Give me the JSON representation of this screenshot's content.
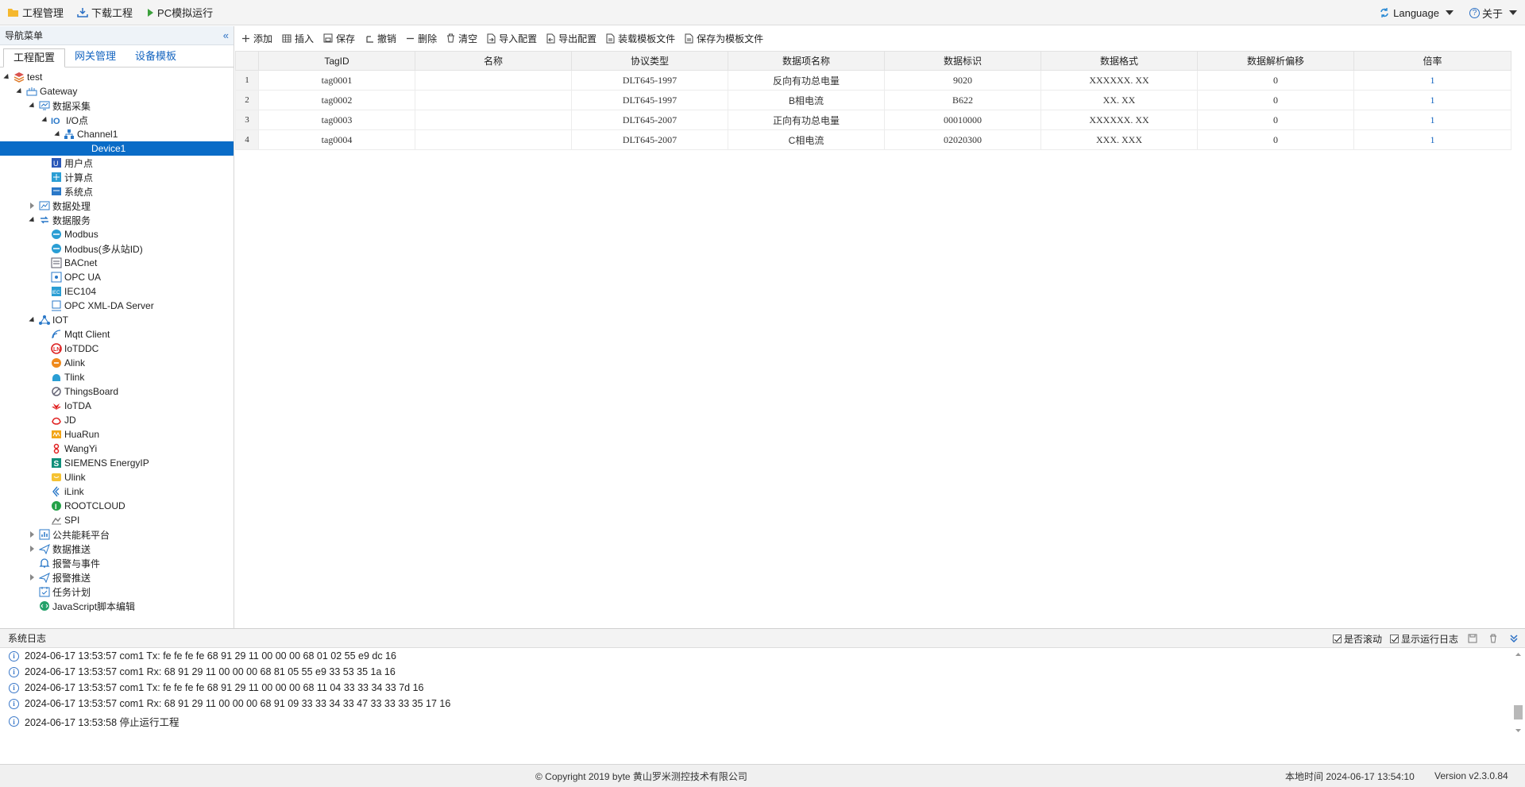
{
  "topbar": {
    "items": [
      {
        "label": "工程管理",
        "icon": "folder-icon"
      },
      {
        "label": "下载工程",
        "icon": "download-icon"
      },
      {
        "label": "PC模拟运行",
        "icon": "play-icon"
      }
    ],
    "language": "Language",
    "about": "关于"
  },
  "nav": {
    "title": "导航菜单",
    "tabs": [
      "工程配置",
      "网关管理",
      "设备模板"
    ],
    "tree": [
      {
        "label": "test",
        "level": 0,
        "toggle": "open",
        "icon": "layers-icon"
      },
      {
        "label": "Gateway",
        "level": 1,
        "toggle": "open",
        "icon": "gateway-icon"
      },
      {
        "label": "数据采集",
        "level": 2,
        "toggle": "open",
        "icon": "monitor-icon"
      },
      {
        "label": "I/O点",
        "level": 3,
        "toggle": "open",
        "icon": "io-icon"
      },
      {
        "label": "Channel1",
        "level": 4,
        "toggle": "open",
        "icon": "channel-icon"
      },
      {
        "label": "Device1",
        "level": 5,
        "toggle": "",
        "icon": "",
        "selected": true
      },
      {
        "label": "用户点",
        "level": 3,
        "toggle": "",
        "icon": "user-point-icon"
      },
      {
        "label": "计算点",
        "level": 3,
        "toggle": "",
        "icon": "calc-point-icon"
      },
      {
        "label": "系统点",
        "level": 3,
        "toggle": "",
        "icon": "system-point-icon"
      },
      {
        "label": "数据处理",
        "level": 2,
        "toggle": "closed",
        "icon": "chart-icon"
      },
      {
        "label": "数据服务",
        "level": 2,
        "toggle": "open",
        "icon": "service-icon"
      },
      {
        "label": "Modbus",
        "level": 3,
        "toggle": "",
        "icon": "modbus-icon"
      },
      {
        "label": "Modbus(多从站ID)",
        "level": 3,
        "toggle": "",
        "icon": "modbus-icon"
      },
      {
        "label": "BACnet",
        "level": 3,
        "toggle": "",
        "icon": "bacnet-icon"
      },
      {
        "label": "OPC UA",
        "level": 3,
        "toggle": "",
        "icon": "opcua-icon"
      },
      {
        "label": "IEC104",
        "level": 3,
        "toggle": "",
        "icon": "iec-icon"
      },
      {
        "label": "OPC XML-DA Server",
        "level": 3,
        "toggle": "",
        "icon": "opc-xml-icon"
      },
      {
        "label": "IOT",
        "level": 2,
        "toggle": "open",
        "icon": "iot-icon"
      },
      {
        "label": "Mqtt Client",
        "level": 3,
        "toggle": "",
        "icon": "mqtt-icon"
      },
      {
        "label": "IoTDDC",
        "level": 3,
        "toggle": "",
        "icon": "iotddc-icon"
      },
      {
        "label": "Alink",
        "level": 3,
        "toggle": "",
        "icon": "alink-icon"
      },
      {
        "label": "Tlink",
        "level": 3,
        "toggle": "",
        "icon": "tlink-icon"
      },
      {
        "label": "ThingsBoard",
        "level": 3,
        "toggle": "",
        "icon": "thingsboard-icon"
      },
      {
        "label": "IoTDA",
        "level": 3,
        "toggle": "",
        "icon": "huawei-icon"
      },
      {
        "label": "JD",
        "level": 3,
        "toggle": "",
        "icon": "jd-icon"
      },
      {
        "label": "HuaRun",
        "level": 3,
        "toggle": "",
        "icon": "huarun-icon"
      },
      {
        "label": "WangYi",
        "level": 3,
        "toggle": "",
        "icon": "wangyi-icon"
      },
      {
        "label": "SIEMENS EnergyIP",
        "level": 3,
        "toggle": "",
        "icon": "siemens-icon"
      },
      {
        "label": "Ulink",
        "level": 3,
        "toggle": "",
        "icon": "ulink-icon"
      },
      {
        "label": "iLink",
        "level": 3,
        "toggle": "",
        "icon": "ilink-icon"
      },
      {
        "label": "ROOTCLOUD",
        "level": 3,
        "toggle": "",
        "icon": "rootcloud-icon"
      },
      {
        "label": "SPI",
        "level": 3,
        "toggle": "",
        "icon": "spi-icon"
      },
      {
        "label": "公共能耗平台",
        "level": 2,
        "toggle": "closed",
        "icon": "energy-icon"
      },
      {
        "label": "数据推送",
        "level": 2,
        "toggle": "closed",
        "icon": "push-icon"
      },
      {
        "label": "报警与事件",
        "level": 2,
        "toggle": "",
        "icon": "bell-icon"
      },
      {
        "label": "报警推送",
        "level": 2,
        "toggle": "closed",
        "icon": "push-icon"
      },
      {
        "label": "任务计划",
        "level": 2,
        "toggle": "",
        "icon": "calendar-icon"
      },
      {
        "label": "JavaScript脚本编辑",
        "level": 2,
        "toggle": "",
        "icon": "script-icon"
      }
    ]
  },
  "toolbar": [
    {
      "label": "添加",
      "icon": "plus-icon",
      "name": "add"
    },
    {
      "label": "插入",
      "icon": "grid-icon",
      "name": "insert"
    },
    {
      "label": "保存",
      "icon": "save-icon",
      "name": "save"
    },
    {
      "label": "撤销",
      "icon": "undo-icon",
      "name": "undo"
    },
    {
      "label": "删除",
      "icon": "minus-icon",
      "name": "delete"
    },
    {
      "label": "清空",
      "icon": "trash-icon",
      "name": "clear"
    },
    {
      "label": "导入配置",
      "icon": "file-import-icon",
      "name": "import-config"
    },
    {
      "label": "导出配置",
      "icon": "file-export-icon",
      "name": "export-config"
    },
    {
      "label": "装载模板文件",
      "icon": "file-icon",
      "name": "load-template"
    },
    {
      "label": "保存为模板文件",
      "icon": "file-icon",
      "name": "save-template"
    }
  ],
  "table": {
    "columns": [
      "",
      "TagID",
      "名称",
      "协议类型",
      "数据项名称",
      "数据标识",
      "数据格式",
      "数据解析偏移",
      "倍率"
    ],
    "rows": [
      [
        "1",
        "tag0001",
        "",
        "DLT645-1997",
        "反向有功总电量",
        "9020",
        "XXXXXX. XX",
        "0",
        "1"
      ],
      [
        "2",
        "tag0002",
        "",
        "DLT645-1997",
        "B相电流",
        "B622",
        "XX. XX",
        "0",
        "1"
      ],
      [
        "3",
        "tag0003",
        "",
        "DLT645-2007",
        "正向有功总电量",
        "00010000",
        "XXXXXX. XX",
        "0",
        "1"
      ],
      [
        "4",
        "tag0004",
        "",
        "DLT645-2007",
        "C相电流",
        "02020300",
        "XXX. XXX",
        "0",
        "1"
      ]
    ]
  },
  "log": {
    "title": "系统日志",
    "autoscroll": "是否滚动",
    "show_run_log": "显示运行日志",
    "lines": [
      "2024-06-17 13:53:57 com1 Tx: fe fe fe fe 68 91 29 11 00 00 00 68 01 02 55 e9 dc 16",
      "2024-06-17 13:53:57 com1 Rx: 68 91 29 11 00 00 00 68 81 05 55 e9 33 53 35 1a 16",
      "2024-06-17 13:53:57 com1 Tx: fe fe fe fe 68 91 29 11 00 00 00 68 11 04 33 33 34 33 7d 16",
      "2024-06-17 13:53:57 com1 Rx: 68 91 29 11 00 00 00 68 91 09 33 33 34 33 47 33 33 33 35 17 16",
      "2024-06-17 13:53:58 停止运行工程"
    ]
  },
  "footer": {
    "copyright": "© Copyright 2019 byte 黄山罗米测控技术有限公司",
    "local_time": "本地时间 2024-06-17 13:54:10",
    "version": "Version v2.3.0.84"
  }
}
